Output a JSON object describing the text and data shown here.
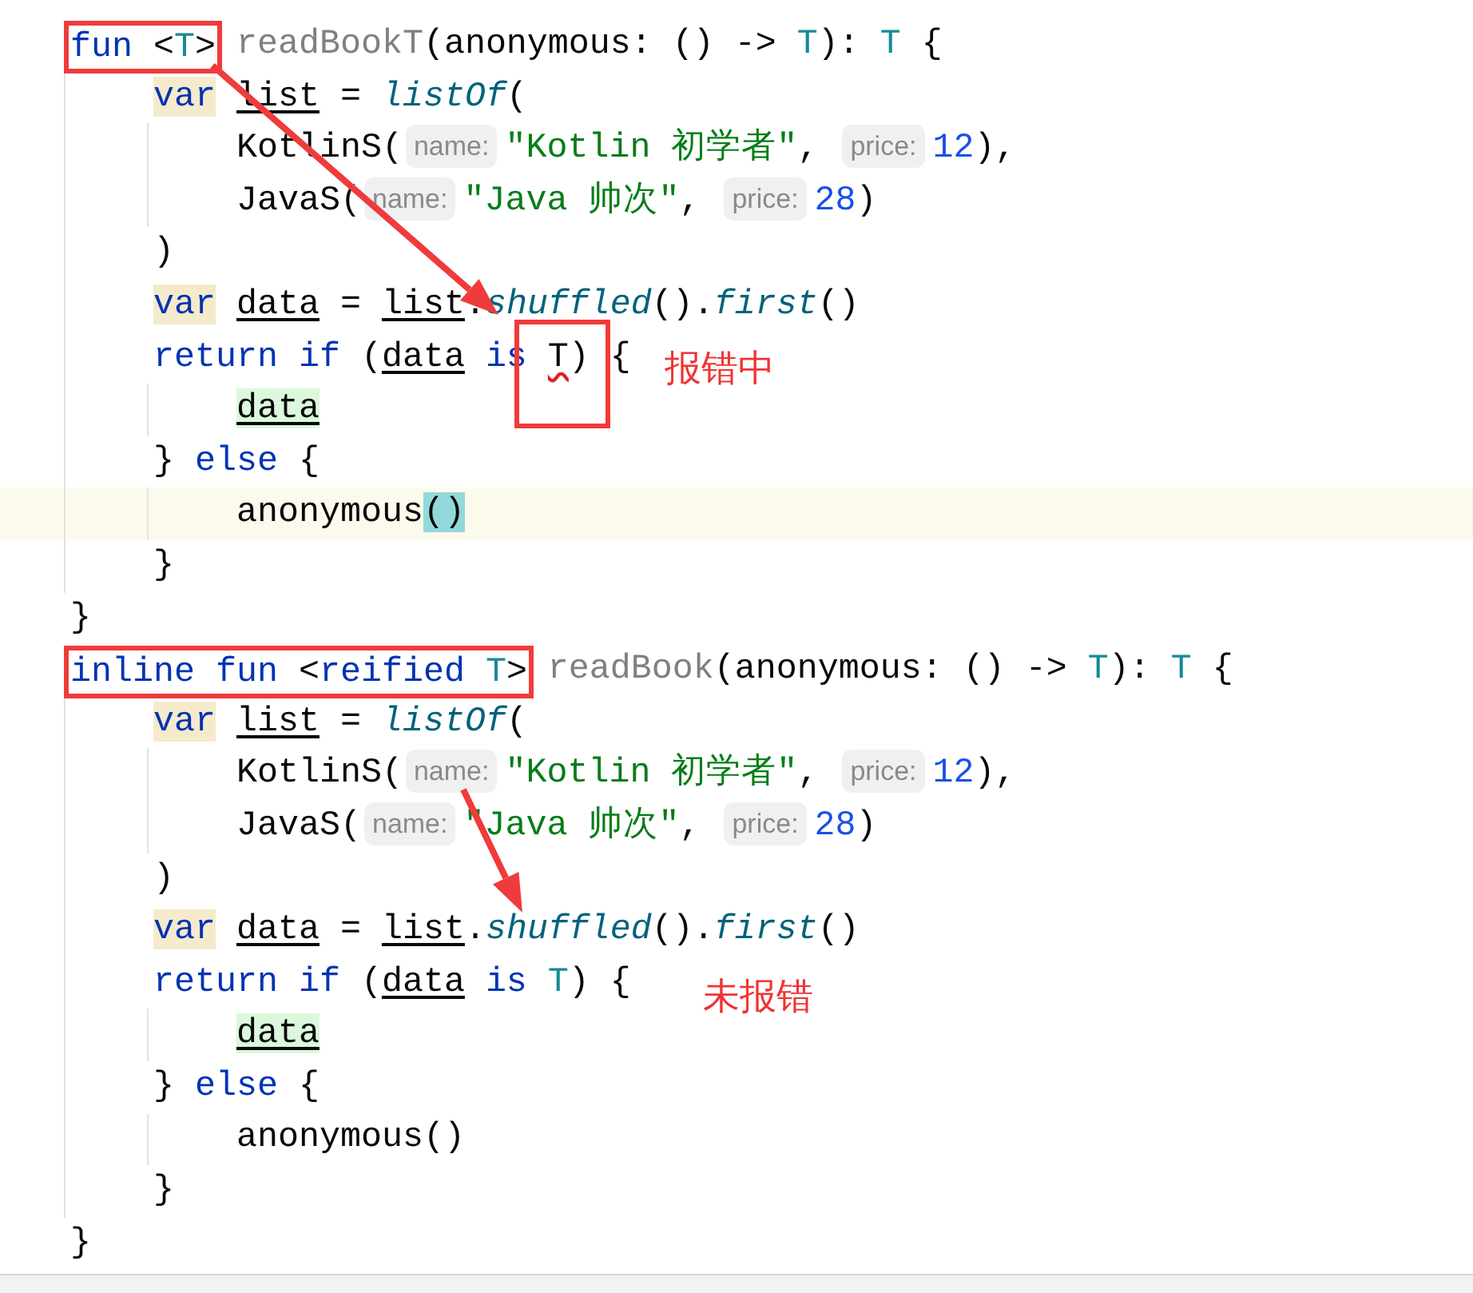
{
  "lines": [
    {
      "current": false,
      "tokens": [
        {
          "kind": "keyword",
          "text": "fun",
          "framed": true
        },
        {
          "kind": "plain",
          "text": " <",
          "framed": true
        },
        {
          "kind": "type_param",
          "text": "T",
          "framed": true
        },
        {
          "kind": "plain",
          "text": ">",
          "framed": true
        },
        {
          "kind": "unused",
          "text": "readBookT",
          "spaced": true
        },
        {
          "kind": "plain",
          "text": "(anonymous: () -> "
        },
        {
          "kind": "type_param",
          "text": "T"
        },
        {
          "kind": "plain",
          "text": "): "
        },
        {
          "kind": "type_param",
          "text": "T"
        },
        {
          "kind": "plain",
          "text": " {"
        }
      ],
      "children": [
        {
          "current": false,
          "tokens": [
            {
              "kind": "keyword_marked",
              "text": "var"
            },
            {
              "kind": "variable",
              "text": "list",
              "spaced": true
            },
            {
              "kind": "plain",
              "text": " = "
            },
            {
              "kind": "call",
              "text": "listOf"
            },
            {
              "kind": "plain",
              "text": "("
            }
          ],
          "children": [
            {
              "current": false,
              "tokens": [
                {
                  "kind": "plain",
                  "text": "KotlinS("
                },
                {
                  "kind": "hint",
                  "text": "name:"
                },
                {
                  "kind": "string",
                  "text": "\"Kotlin 初学者\""
                },
                {
                  "kind": "plain",
                  "text": ", "
                },
                {
                  "kind": "hint",
                  "text": "price:"
                },
                {
                  "kind": "number",
                  "text": "12"
                },
                {
                  "kind": "plain",
                  "text": "),"
                }
              ]
            },
            {
              "current": false,
              "tokens": [
                {
                  "kind": "plain",
                  "text": "JavaS("
                },
                {
                  "kind": "hint",
                  "text": "name:"
                },
                {
                  "kind": "string",
                  "text": "\"Java 帅次\""
                },
                {
                  "kind": "plain",
                  "text": ", "
                },
                {
                  "kind": "hint",
                  "text": "price:"
                },
                {
                  "kind": "number",
                  "text": "28"
                },
                {
                  "kind": "plain",
                  "text": ")"
                }
              ]
            }
          ]
        },
        {
          "current": false,
          "tokens": [
            {
              "kind": "plain",
              "text": ")"
            }
          ]
        },
        {
          "current": false,
          "tokens": [
            {
              "kind": "keyword_marked",
              "text": "var"
            },
            {
              "kind": "variable",
              "text": "data",
              "spaced": true
            },
            {
              "kind": "plain",
              "text": " = "
            },
            {
              "kind": "variable",
              "text": "list"
            },
            {
              "kind": "plain",
              "text": "."
            },
            {
              "kind": "call",
              "text": "shuffled"
            },
            {
              "kind": "plain",
              "text": "()."
            },
            {
              "kind": "call",
              "text": "first"
            },
            {
              "kind": "plain",
              "text": "()"
            }
          ]
        },
        {
          "current": false,
          "tokens": [
            {
              "kind": "keyword",
              "text": "return"
            },
            {
              "kind": "keyword",
              "text": "if",
              "spaced": true
            },
            {
              "kind": "plain",
              "text": " ("
            },
            {
              "kind": "variable",
              "text": "data"
            },
            {
              "kind": "keyword",
              "text": "is",
              "spaced": true
            },
            {
              "kind": "error",
              "text": "T",
              "spaced": true
            },
            {
              "kind": "plain",
              "text": ") {"
            }
          ],
          "children": [
            {
              "current": false,
              "tokens": [
                {
                  "kind": "smart_cast",
                  "text": "data"
                }
              ]
            }
          ]
        },
        {
          "current": false,
          "tokens": [
            {
              "kind": "plain",
              "text": "} "
            },
            {
              "kind": "keyword",
              "text": "else"
            },
            {
              "kind": "plain",
              "text": " {"
            }
          ],
          "children": [
            {
              "current": true,
              "tokens": [
                {
                  "kind": "plain",
                  "text": "anonymous"
                },
                {
                  "kind": "brace_match",
                  "text": "()"
                }
              ]
            }
          ]
        },
        {
          "current": false,
          "tokens": [
            {
              "kind": "plain",
              "text": "}"
            }
          ]
        }
      ]
    },
    {
      "current": false,
      "tokens": [
        {
          "kind": "plain",
          "text": "}"
        }
      ]
    },
    {
      "current": false,
      "tokens": [
        {
          "kind": "keyword",
          "text": "inline",
          "framed": true
        },
        {
          "kind": "keyword",
          "text": "fun",
          "spaced": true,
          "framed": true
        },
        {
          "kind": "plain",
          "text": " <",
          "framed": true
        },
        {
          "kind": "keyword",
          "text": "reified",
          "framed": true
        },
        {
          "kind": "type_param",
          "text": "T",
          "spaced": true,
          "framed": true
        },
        {
          "kind": "plain",
          "text": ">",
          "framed": true
        },
        {
          "kind": "unused",
          "text": "readBook",
          "spaced": true
        },
        {
          "kind": "plain",
          "text": "(anonymous: () -> "
        },
        {
          "kind": "type_param",
          "text": "T"
        },
        {
          "kind": "plain",
          "text": "): "
        },
        {
          "kind": "type_param",
          "text": "T"
        },
        {
          "kind": "plain",
          "text": " {"
        }
      ],
      "children": [
        {
          "current": false,
          "tokens": [
            {
              "kind": "keyword_marked",
              "text": "var"
            },
            {
              "kind": "variable",
              "text": "list",
              "spaced": true
            },
            {
              "kind": "plain",
              "text": " = "
            },
            {
              "kind": "call",
              "text": "listOf"
            },
            {
              "kind": "plain",
              "text": "("
            }
          ],
          "children": [
            {
              "current": false,
              "tokens": [
                {
                  "kind": "plain",
                  "text": "KotlinS("
                },
                {
                  "kind": "hint",
                  "text": "name:"
                },
                {
                  "kind": "string",
                  "text": "\"Kotlin 初学者\""
                },
                {
                  "kind": "plain",
                  "text": ", "
                },
                {
                  "kind": "hint",
                  "text": "price:"
                },
                {
                  "kind": "number",
                  "text": "12"
                },
                {
                  "kind": "plain",
                  "text": "),"
                }
              ]
            },
            {
              "current": false,
              "tokens": [
                {
                  "kind": "plain",
                  "text": "JavaS("
                },
                {
                  "kind": "hint",
                  "text": "name:"
                },
                {
                  "kind": "string",
                  "text": "\"Java 帅次\""
                },
                {
                  "kind": "plain",
                  "text": ", "
                },
                {
                  "kind": "hint",
                  "text": "price:"
                },
                {
                  "kind": "number",
                  "text": "28"
                },
                {
                  "kind": "plain",
                  "text": ")"
                }
              ]
            }
          ]
        },
        {
          "current": false,
          "tokens": [
            {
              "kind": "plain",
              "text": ")"
            }
          ]
        },
        {
          "current": false,
          "tokens": [
            {
              "kind": "keyword_marked",
              "text": "var"
            },
            {
              "kind": "variable",
              "text": "data",
              "spaced": true
            },
            {
              "kind": "plain",
              "text": " = "
            },
            {
              "kind": "variable",
              "text": "list"
            },
            {
              "kind": "plain",
              "text": "."
            },
            {
              "kind": "call",
              "text": "shuffled"
            },
            {
              "kind": "plain",
              "text": "()."
            },
            {
              "kind": "call",
              "text": "first"
            },
            {
              "kind": "plain",
              "text": "()"
            }
          ]
        },
        {
          "current": false,
          "tokens": [
            {
              "kind": "keyword",
              "text": "return"
            },
            {
              "kind": "keyword",
              "text": "if",
              "spaced": true
            },
            {
              "kind": "plain",
              "text": " ("
            },
            {
              "kind": "variable",
              "text": "data"
            },
            {
              "kind": "keyword",
              "text": "is",
              "spaced": true
            },
            {
              "kind": "type_param",
              "text": "T",
              "spaced": true
            },
            {
              "kind": "plain",
              "text": ") {"
            }
          ],
          "children": [
            {
              "current": false,
              "tokens": [
                {
                  "kind": "smart_cast",
                  "text": "data"
                }
              ]
            }
          ]
        },
        {
          "current": false,
          "tokens": [
            {
              "kind": "plain",
              "text": "} "
            },
            {
              "kind": "keyword",
              "text": "else"
            },
            {
              "kind": "plain",
              "text": " {"
            }
          ],
          "children": [
            {
              "current": false,
              "tokens": [
                {
                  "kind": "plain",
                  "text": "anonymous()"
                }
              ]
            }
          ]
        },
        {
          "current": false,
          "tokens": [
            {
              "kind": "plain",
              "text": "}"
            }
          ]
        }
      ]
    },
    {
      "current": false,
      "tokens": [
        {
          "kind": "plain",
          "text": "}"
        }
      ]
    }
  ],
  "annotations": [
    {
      "kind": "frame"
    },
    {
      "kind": "arrow"
    },
    {
      "kind": "arrow"
    },
    {
      "kind": "note",
      "text": "报错中"
    },
    {
      "kind": "note",
      "text": "未报错"
    }
  ]
}
